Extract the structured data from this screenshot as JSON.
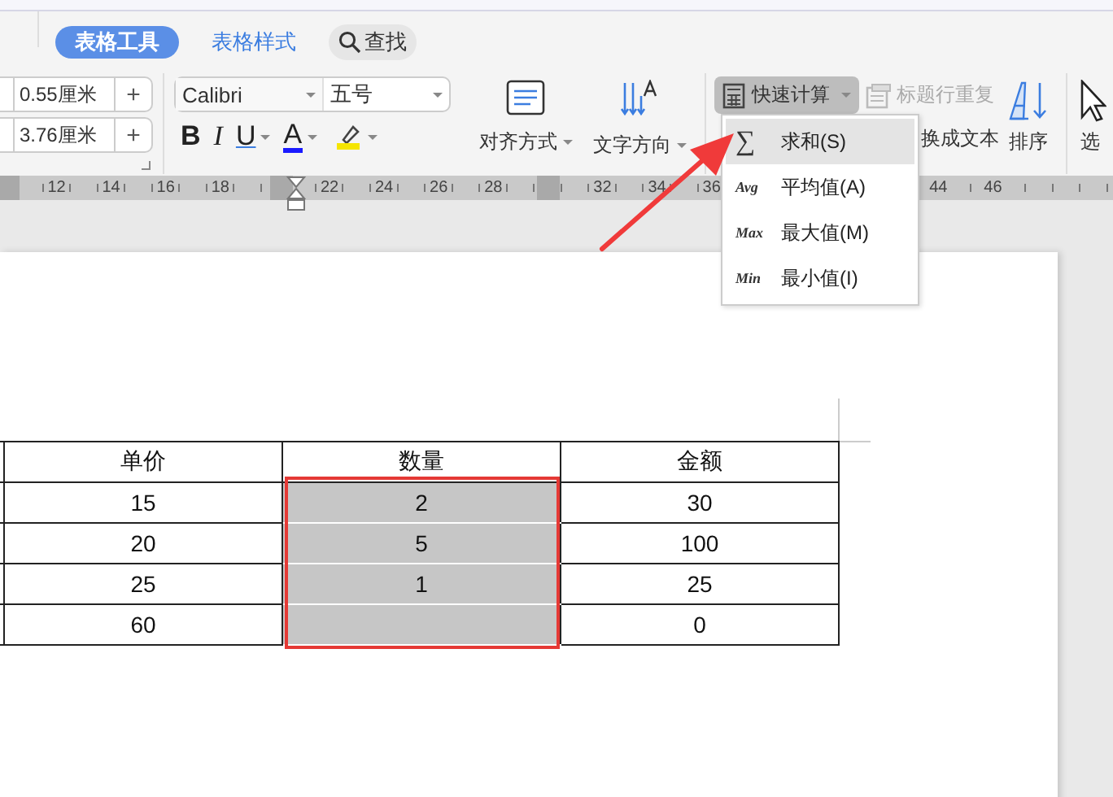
{
  "tabs": [
    {
      "label": "表格工具",
      "selected": true
    },
    {
      "label": "表格样式",
      "selected": false
    }
  ],
  "search": {
    "label": "查找"
  },
  "cell_size": [
    {
      "value": "0.55厘米",
      "plus": "+"
    },
    {
      "value": "3.76厘米",
      "plus": "+"
    }
  ],
  "font": {
    "name": "Calibri",
    "size": "五号"
  },
  "format_buttons": [
    {
      "kind": "bold",
      "label": "B"
    },
    {
      "kind": "italic",
      "label": "I"
    },
    {
      "kind": "underline",
      "label": "U"
    },
    {
      "kind": "font_color",
      "label": "A"
    },
    {
      "kind": "highlight"
    }
  ],
  "tools": [
    {
      "kind": "align",
      "label": "对齐方式"
    },
    {
      "kind": "direction",
      "label": "文字方向"
    }
  ],
  "quick_calc": {
    "label": "快速计算",
    "open": true
  },
  "repeat_header": {
    "label": "标题行重复",
    "disabled": true
  },
  "convert": {
    "label": "换成文本"
  },
  "sort": {
    "label": "排序"
  },
  "select": {
    "label": "选"
  },
  "ruler": {
    "sections": [
      {
        "labels": [
          "12",
          "14",
          "16",
          "18"
        ]
      },
      {
        "labels": [
          "22",
          "24",
          "26",
          "28"
        ]
      },
      {
        "labels": [
          "32",
          "34",
          "36"
        ]
      },
      {
        "labels": [
          "44",
          "46"
        ]
      }
    ]
  },
  "menu": [
    {
      "icon_text": "∑",
      "label": "求和(S)",
      "selected": true
    },
    {
      "icon_text": "Avg",
      "label": "平均值(A)",
      "selected": false
    },
    {
      "icon_text": "Max",
      "label": "最大值(M)",
      "selected": false
    },
    {
      "icon_text": "Min",
      "label": "最小值(I)",
      "selected": false
    }
  ],
  "table": {
    "columns": [
      {
        "label": "单价",
        "selected": false
      },
      {
        "label": "数量",
        "selected": true
      },
      {
        "label": "金额",
        "selected": false
      }
    ],
    "rows": [
      [
        "15",
        "2",
        "30"
      ],
      [
        "20",
        "5",
        "100"
      ],
      [
        "25",
        "1",
        "25"
      ],
      [
        "60",
        null,
        "0"
      ]
    ]
  }
}
